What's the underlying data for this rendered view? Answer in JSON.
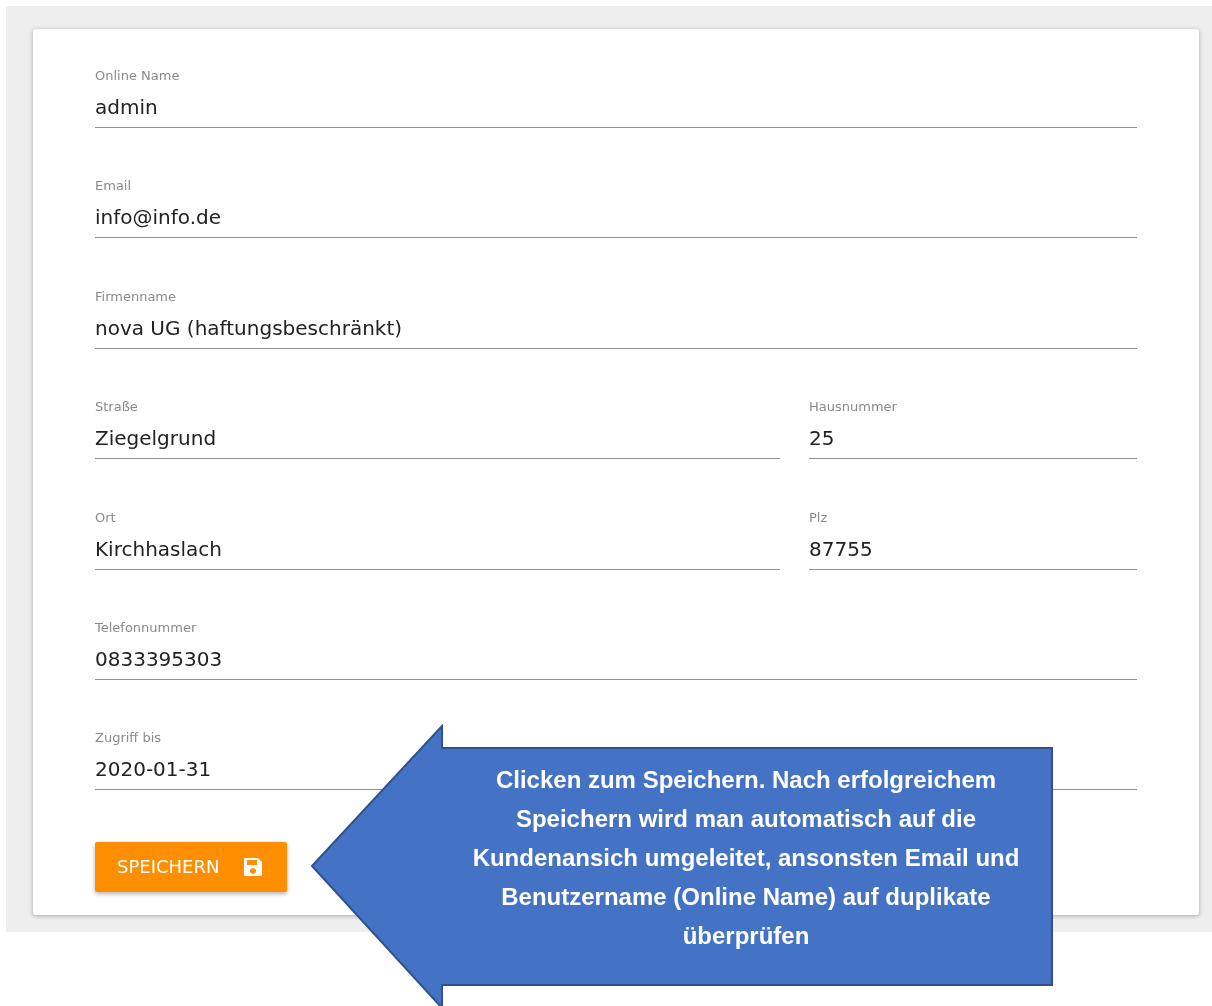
{
  "form": {
    "rows": [
      [
        {
          "label": "Online Name",
          "value": "admin"
        }
      ],
      [
        {
          "label": "Email",
          "value": "info@info.de"
        }
      ],
      [
        {
          "label": "Firmenname",
          "value": "nova UG (haftungsbeschränkt)"
        }
      ],
      [
        {
          "label": "Straße",
          "value": "Ziegelgrund"
        },
        {
          "label": "Hausnummer",
          "value": "25"
        }
      ],
      [
        {
          "label": "Ort",
          "value": "Kirchhaslach"
        },
        {
          "label": "Plz",
          "value": "87755"
        }
      ],
      [
        {
          "label": "Telefonnummer",
          "value": "0833395303"
        }
      ],
      [
        {
          "label": "Zugriff bis",
          "value": "2020-01-31"
        }
      ]
    ],
    "save_button": {
      "label": "SPEICHERN"
    }
  },
  "callout": {
    "text": "Clicken zum Speichern. Nach erfolgreichem Speichern wird man automatisch auf die Kundenansich umgeleitet, ansonsten Email und Benutzername (Online Name) auf duplikate überprüfen"
  }
}
